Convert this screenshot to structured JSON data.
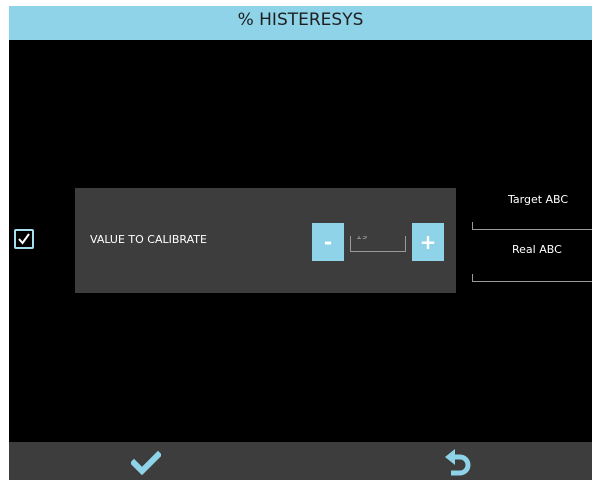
{
  "header": {
    "title": "% HISTERESYS"
  },
  "calibration": {
    "label": "VALUE TO CALIBRATE",
    "minus_label": "-",
    "plus_label": "+",
    "value": "19",
    "checked": true
  },
  "readouts": {
    "target_label": "Target ABC",
    "real_label": "Real ABC"
  },
  "footer": {
    "confirm_icon": "checkmark-icon",
    "back_icon": "undo-arrow-icon"
  },
  "colors": {
    "accent": "#8fd3e8",
    "panel": "#3d3d3d",
    "background": "#000000"
  }
}
